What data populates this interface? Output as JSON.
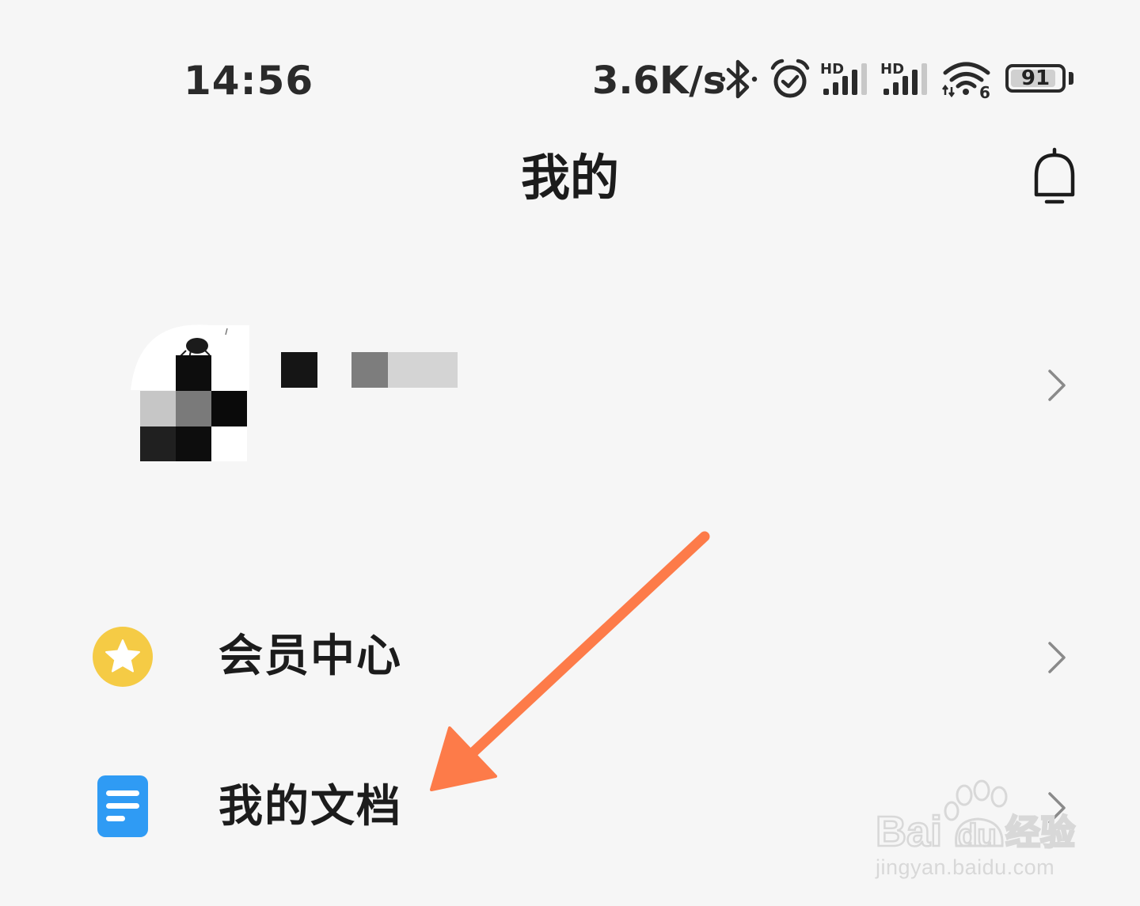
{
  "status_bar": {
    "time": "14:56",
    "network_speed": "3.6K/s",
    "battery_level": "91",
    "battery_fraction": 0.91,
    "icons": [
      "bluetooth-icon",
      "alarm-icon",
      "hd-signal-icon",
      "hd-signal-icon",
      "wifi-6-icon",
      "battery-icon"
    ],
    "hd_label": "HD",
    "wifi_label": "6"
  },
  "header": {
    "title": "我的",
    "bell_icon": "notification-bell-icon"
  },
  "profile": {
    "avatar_icon": "pixelated-avatar",
    "name_redacted": true
  },
  "menu": {
    "items": [
      {
        "label": "会员中心",
        "icon": "star-icon",
        "icon_color": "#f5cb45"
      },
      {
        "label": "我的文档",
        "icon": "document-icon",
        "icon_color": "#2f9bf4"
      }
    ]
  },
  "annotation": {
    "arrow_color": "#fd7b49"
  },
  "watermark": {
    "brand": "Bai du 经验",
    "url": "jingyan.baidu.com"
  }
}
